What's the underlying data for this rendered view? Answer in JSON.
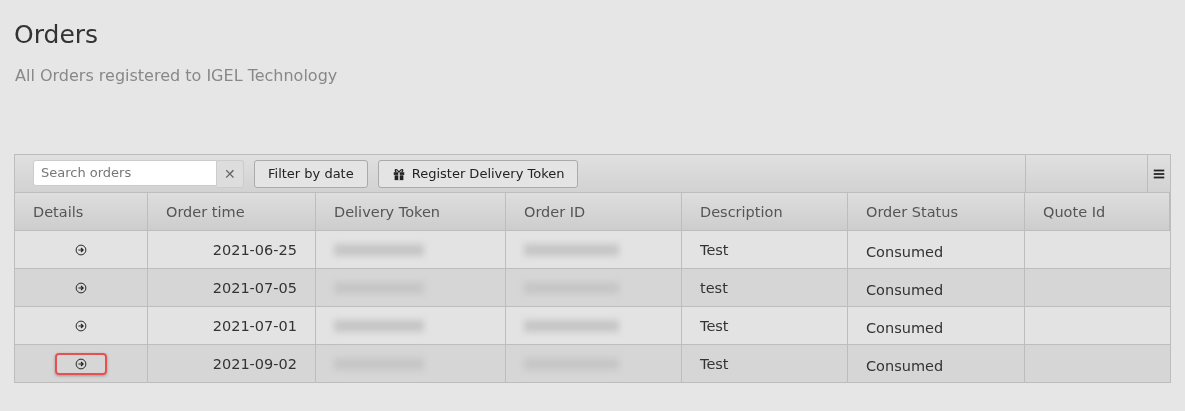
{
  "page": {
    "title": "Orders",
    "subtitle": "All Orders registered to IGEL Technology"
  },
  "toolbar": {
    "search": {
      "placeholder": "Search orders",
      "clear": "✕"
    },
    "buttons": [
      {
        "label": "Filter by date",
        "kind": "plain"
      },
      {
        "label": "Register Delivery Token",
        "kind": "iconic"
      }
    ]
  },
  "table": {
    "columns": [
      "Details",
      "Order time",
      "Delivery Token",
      "Order ID",
      "Description",
      "Order Status",
      "Quote Id"
    ],
    "rows": [
      {
        "highlighted": false,
        "order_time": "2021-06-25",
        "delivery_token_redacted": true,
        "order_id_redacted": true,
        "description": "Test",
        "order_status": "Consumed"
      },
      {
        "highlighted": false,
        "order_time": "2021-07-05",
        "delivery_token_redacted": true,
        "order_id_redacted": true,
        "description": "test",
        "order_status": "Consumed"
      },
      {
        "highlighted": false,
        "order_time": "2021-07-01",
        "delivery_token_redacted": true,
        "order_id_redacted": true,
        "description": "Test",
        "order_status": "Consumed"
      },
      {
        "highlighted": true,
        "order_time": "2021-09-02",
        "delivery_token_redacted": true,
        "order_id_redacted": true,
        "description": "Test",
        "order_status": "Consumed"
      }
    ]
  }
}
